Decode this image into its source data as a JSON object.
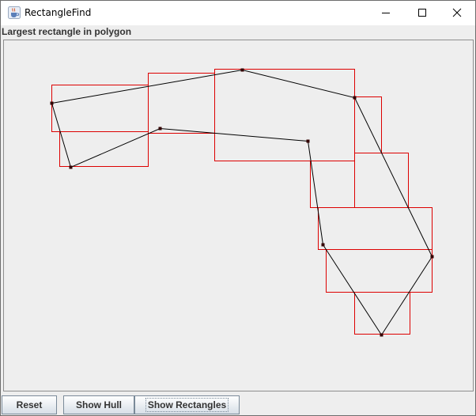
{
  "window": {
    "title": "RectangleFind",
    "icon": "java-coffee-cup-icon"
  },
  "controls": {
    "minimize_icon": "minimize-icon",
    "maximize_icon": "maximize-icon",
    "close_icon": "close-icon"
  },
  "heading": "Largest rectangle in polygon",
  "buttons": {
    "reset": "Reset",
    "show_hull": "Show Hull",
    "show_rectangles": "Show Rectangles"
  },
  "colors": {
    "polygon_stroke": "#000000",
    "vertex": "#330000",
    "rectangle_stroke": "#dd0000",
    "canvas_background": "#eeeeee"
  }
}
